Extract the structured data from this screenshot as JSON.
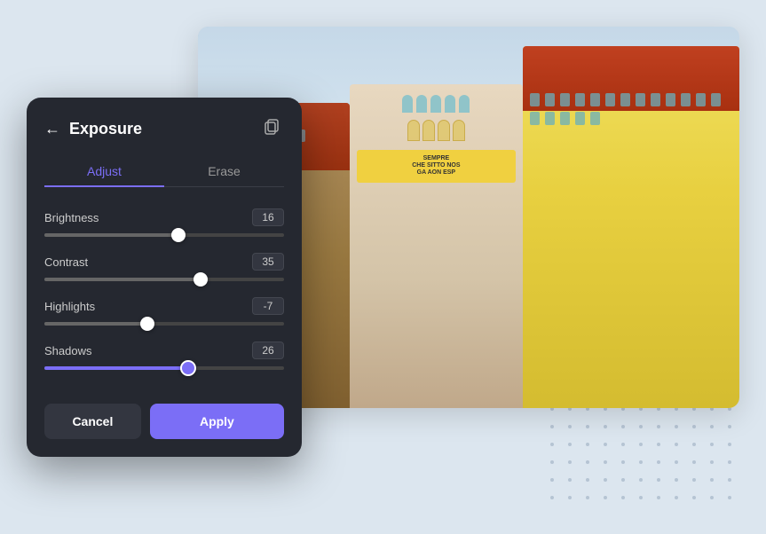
{
  "background": {
    "color": "#dce6ef"
  },
  "panel": {
    "title": "Exposure",
    "back_label": "←",
    "tabs": [
      {
        "id": "adjust",
        "label": "Adjust",
        "active": true
      },
      {
        "id": "erase",
        "label": "Erase",
        "active": false
      }
    ],
    "sliders": [
      {
        "id": "brightness",
        "label": "Brightness",
        "value": 16,
        "percent": 56
      },
      {
        "id": "contrast",
        "label": "Contrast",
        "value": 35,
        "percent": 65
      },
      {
        "id": "highlights",
        "label": "Highlights",
        "value": -7,
        "percent": 43
      },
      {
        "id": "shadows",
        "label": "Shadows",
        "value": 26,
        "percent": 60
      }
    ],
    "buttons": {
      "cancel": "Cancel",
      "apply": "Apply"
    }
  }
}
